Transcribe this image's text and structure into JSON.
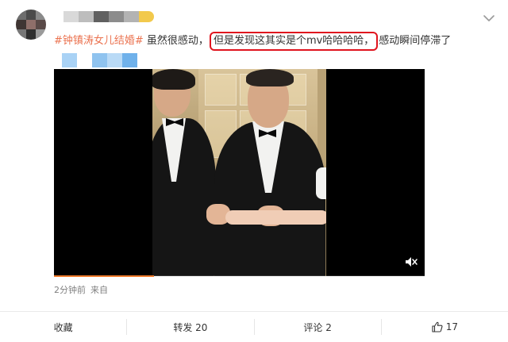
{
  "post": {
    "hashtag": "#钟镇涛女儿结婚#",
    "text_before": " 虽然很感动，",
    "text_highlight": "但是发现这其实是个mv哈哈哈哈，",
    "text_after": "感动瞬间停滞了",
    "highlight_color": "#e0141e",
    "hashtag_color": "#eb7350"
  },
  "icons": {
    "menu": "chevron-down-icon",
    "mute": "volume-mute-icon",
    "like": "thumbs-up-icon"
  },
  "video": {
    "progress": 0.27,
    "progress_color": "#f07b2c"
  },
  "meta": {
    "time": "2分钟前",
    "source": "来自"
  },
  "actions": {
    "favorite": "收藏",
    "repost": "转发 20",
    "comment": "评论 2",
    "like": "17"
  }
}
